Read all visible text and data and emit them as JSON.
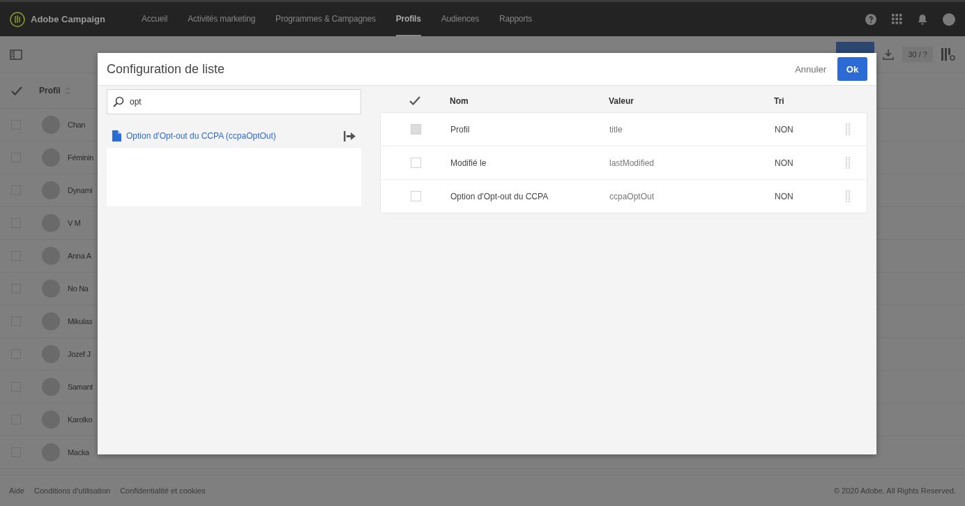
{
  "app": {
    "name": "Adobe Campaign"
  },
  "nav": [
    {
      "label": "Accueil",
      "selected": false
    },
    {
      "label": "Activités marketing",
      "selected": false
    },
    {
      "label": "Programmes & Campagnes",
      "selected": false
    },
    {
      "label": "Profils",
      "selected": true
    },
    {
      "label": "Audiences",
      "selected": false
    },
    {
      "label": "Rapports",
      "selected": false
    }
  ],
  "toolbar": {
    "count": "30 / ?"
  },
  "table": {
    "column": "Profil",
    "rows": [
      {
        "name": "Chan",
        "checked": false
      },
      {
        "name": "Féminin",
        "checked": false
      },
      {
        "name": "Dynami",
        "checked": false
      },
      {
        "name": "V M",
        "checked": false
      },
      {
        "name": "Anna A",
        "checked": false
      },
      {
        "name": "No Na",
        "checked": false
      },
      {
        "name": "Mikulas",
        "checked": false
      },
      {
        "name": "Jozef J",
        "checked": false
      },
      {
        "name": "Samant",
        "checked": false
      },
      {
        "name": "Karolko",
        "checked": false
      },
      {
        "name": "Macka",
        "checked": false
      }
    ]
  },
  "dialog": {
    "title": "Configuration de liste",
    "cancel": "Annuler",
    "ok": "Ok",
    "search": {
      "value": "opt"
    },
    "results": [
      {
        "label": "Option d'Opt-out du CCPA (ccpaOptOut)"
      }
    ],
    "columns": [
      "Nom",
      "Valeur",
      "Tri"
    ],
    "fields": [
      {
        "name": "Profil",
        "value": "title",
        "sort": "NON",
        "disabled": true
      },
      {
        "name": "Modifié le",
        "value": "lastModified",
        "sort": "NON",
        "disabled": false
      },
      {
        "name": "Option d'Opt-out du CCPA",
        "value": "ccpaOptOut",
        "sort": "NON",
        "disabled": false
      }
    ]
  },
  "footer": {
    "links": [
      "Aide",
      "Conditions d'utilisation",
      "Confidentialité et cookies"
    ],
    "copyright": "© 2020 Adobe. All Rights Reserved."
  }
}
